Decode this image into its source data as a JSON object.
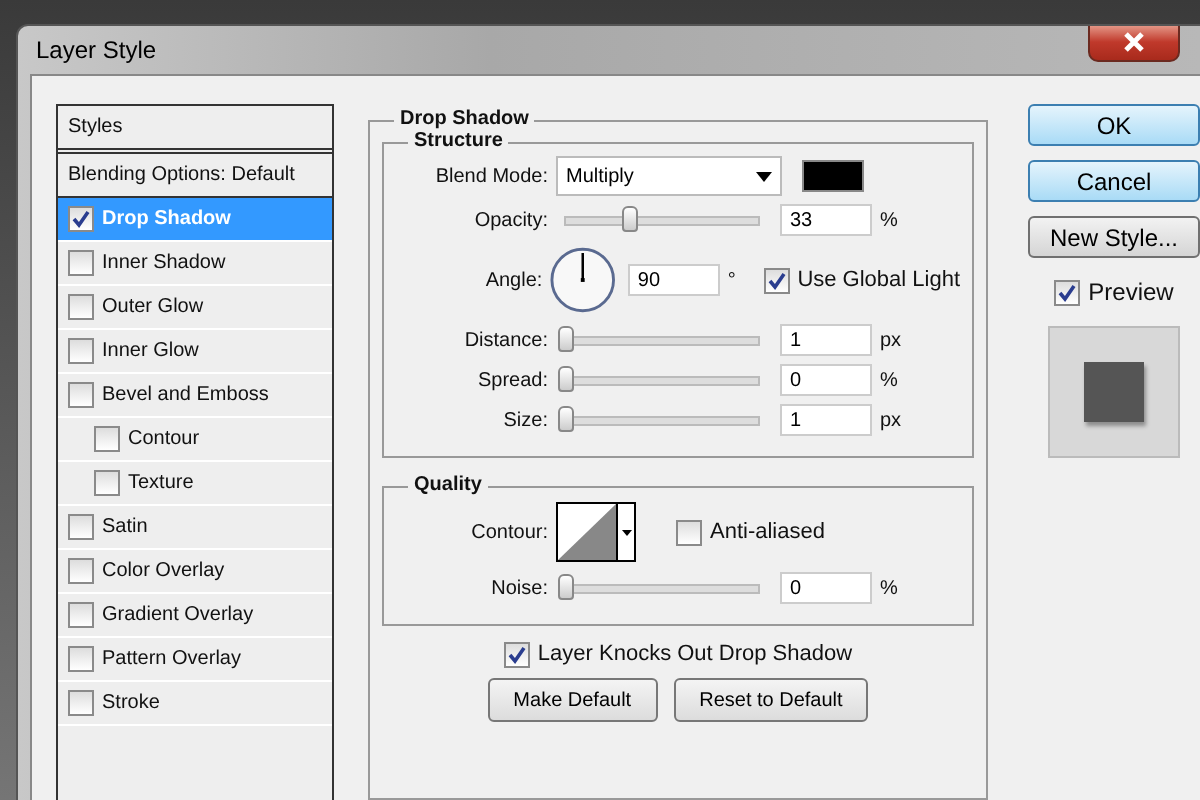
{
  "window": {
    "title": "Layer Style"
  },
  "styles": [
    {
      "label": "Styles",
      "kind": "header"
    },
    {
      "label": "Blending Options: Default",
      "kind": "plain",
      "selected": false
    },
    {
      "label": "Drop Shadow",
      "kind": "check",
      "checked": true,
      "selected": true
    },
    {
      "label": "Inner Shadow",
      "kind": "check",
      "checked": false,
      "selected": false
    },
    {
      "label": "Outer Glow",
      "kind": "check",
      "checked": false,
      "selected": false
    },
    {
      "label": "Inner Glow",
      "kind": "check",
      "checked": false,
      "selected": false
    },
    {
      "label": "Bevel and Emboss",
      "kind": "check",
      "checked": false,
      "selected": false,
      "children": [
        {
          "label": "Contour",
          "kind": "check",
          "checked": false,
          "selected": false
        },
        {
          "label": "Texture",
          "kind": "check",
          "checked": false,
          "selected": false
        }
      ]
    },
    {
      "label": "Satin",
      "kind": "check",
      "checked": false,
      "selected": false
    },
    {
      "label": "Color Overlay",
      "kind": "check",
      "checked": false,
      "selected": false
    },
    {
      "label": "Gradient Overlay",
      "kind": "check",
      "checked": false,
      "selected": false
    },
    {
      "label": "Pattern Overlay",
      "kind": "check",
      "checked": false,
      "selected": false
    },
    {
      "label": "Stroke",
      "kind": "check",
      "checked": false,
      "selected": false
    }
  ],
  "drop_shadow": {
    "title": "Drop Shadow",
    "structure": {
      "title": "Structure",
      "blend_mode": {
        "label": "Blend Mode:",
        "value": "Multiply",
        "color": "#000000"
      },
      "rows": [
        {
          "kind": "slider",
          "label": "Opacity:",
          "level": 0.33,
          "value": "33",
          "unit": "%"
        },
        {
          "kind": "angle",
          "label": "Angle:",
          "value": "90",
          "unit": "°",
          "global_light": {
            "label": "Use Global Light",
            "checked": true
          }
        },
        {
          "kind": "slider",
          "label": "Distance:",
          "level": 0,
          "value": "1",
          "unit": "px"
        },
        {
          "kind": "slider",
          "label": "Spread:",
          "level": 0,
          "value": "0",
          "unit": "%"
        },
        {
          "kind": "slider",
          "label": "Size:",
          "level": 0,
          "value": "1",
          "unit": "px"
        }
      ]
    },
    "quality": {
      "title": "Quality",
      "contour_label": "Contour:",
      "anti_aliased": {
        "label": "Anti-aliased",
        "checked": false
      },
      "noise": {
        "label": "Noise:",
        "level": 0,
        "value": "0",
        "unit": "%"
      }
    },
    "knockout": {
      "label": "Layer Knocks Out Drop Shadow",
      "checked": true
    },
    "buttons": [
      "Make Default",
      "Reset to Default"
    ]
  },
  "actions": [
    {
      "label": "OK",
      "kind": "primary"
    },
    {
      "label": "Cancel",
      "kind": "primary"
    },
    {
      "label": "New Style...",
      "kind": "plain"
    }
  ],
  "preview": {
    "label": "Preview",
    "checked": true
  }
}
